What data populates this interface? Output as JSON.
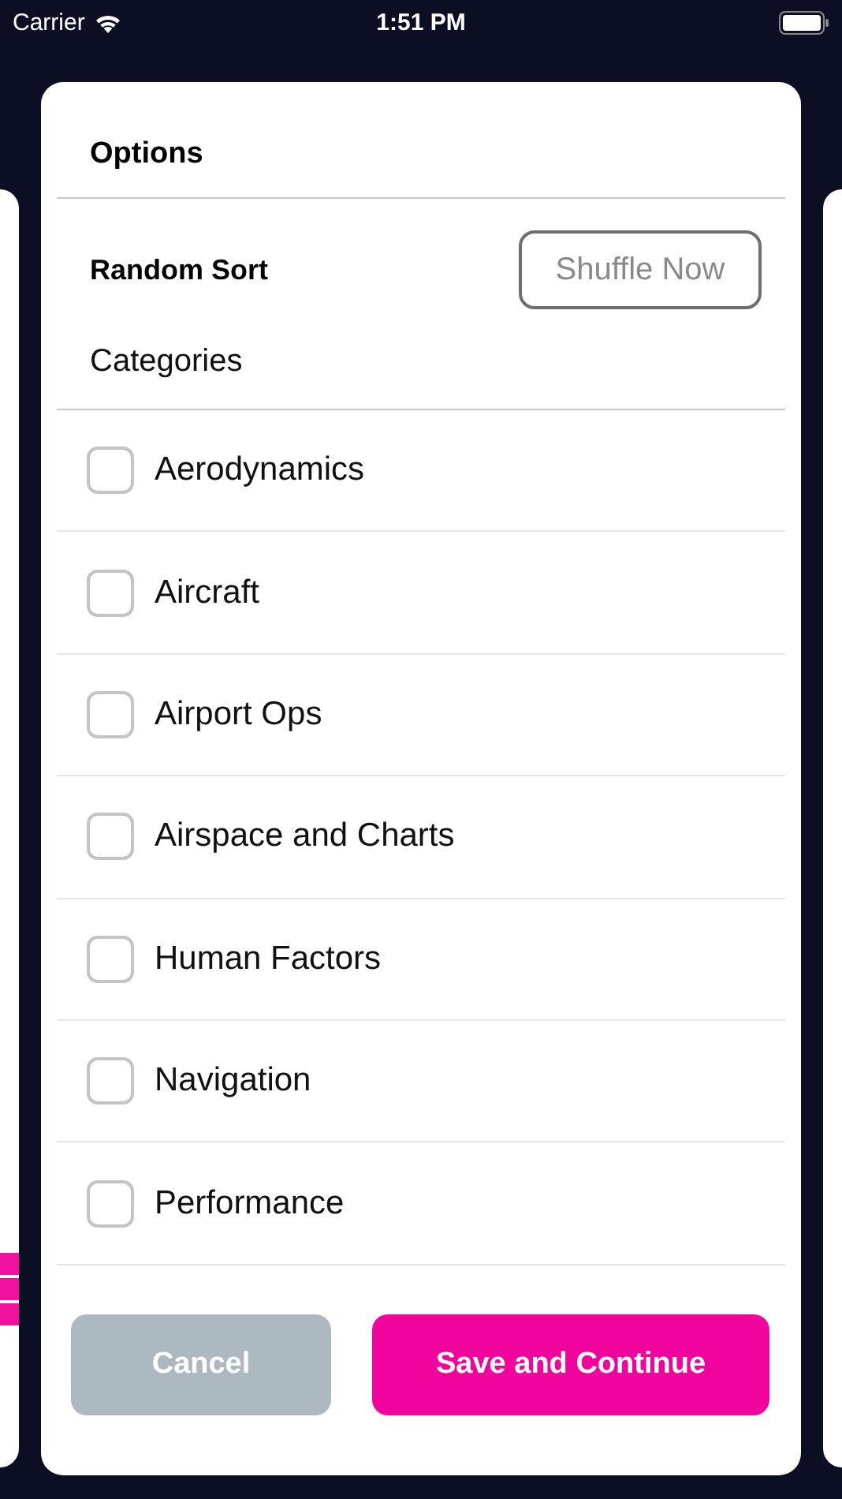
{
  "status_bar": {
    "carrier": "Carrier",
    "time": "1:51 PM"
  },
  "dialog": {
    "title": "Options",
    "random_sort": {
      "label": "Random Sort",
      "button": "Shuffle Now"
    },
    "categories_label": "Categories",
    "categories": [
      {
        "label": "Aerodynamics",
        "checked": false
      },
      {
        "label": "Aircraft",
        "checked": false
      },
      {
        "label": "Airport Ops",
        "checked": false
      },
      {
        "label": "Airspace and Charts",
        "checked": false
      },
      {
        "label": "Human Factors",
        "checked": false
      },
      {
        "label": "Navigation",
        "checked": false
      },
      {
        "label": "Performance",
        "checked": false
      }
    ],
    "buttons": [
      {
        "label": "Cancel",
        "kind": "secondary"
      },
      {
        "label": "Save and Continue",
        "kind": "primary"
      }
    ]
  }
}
